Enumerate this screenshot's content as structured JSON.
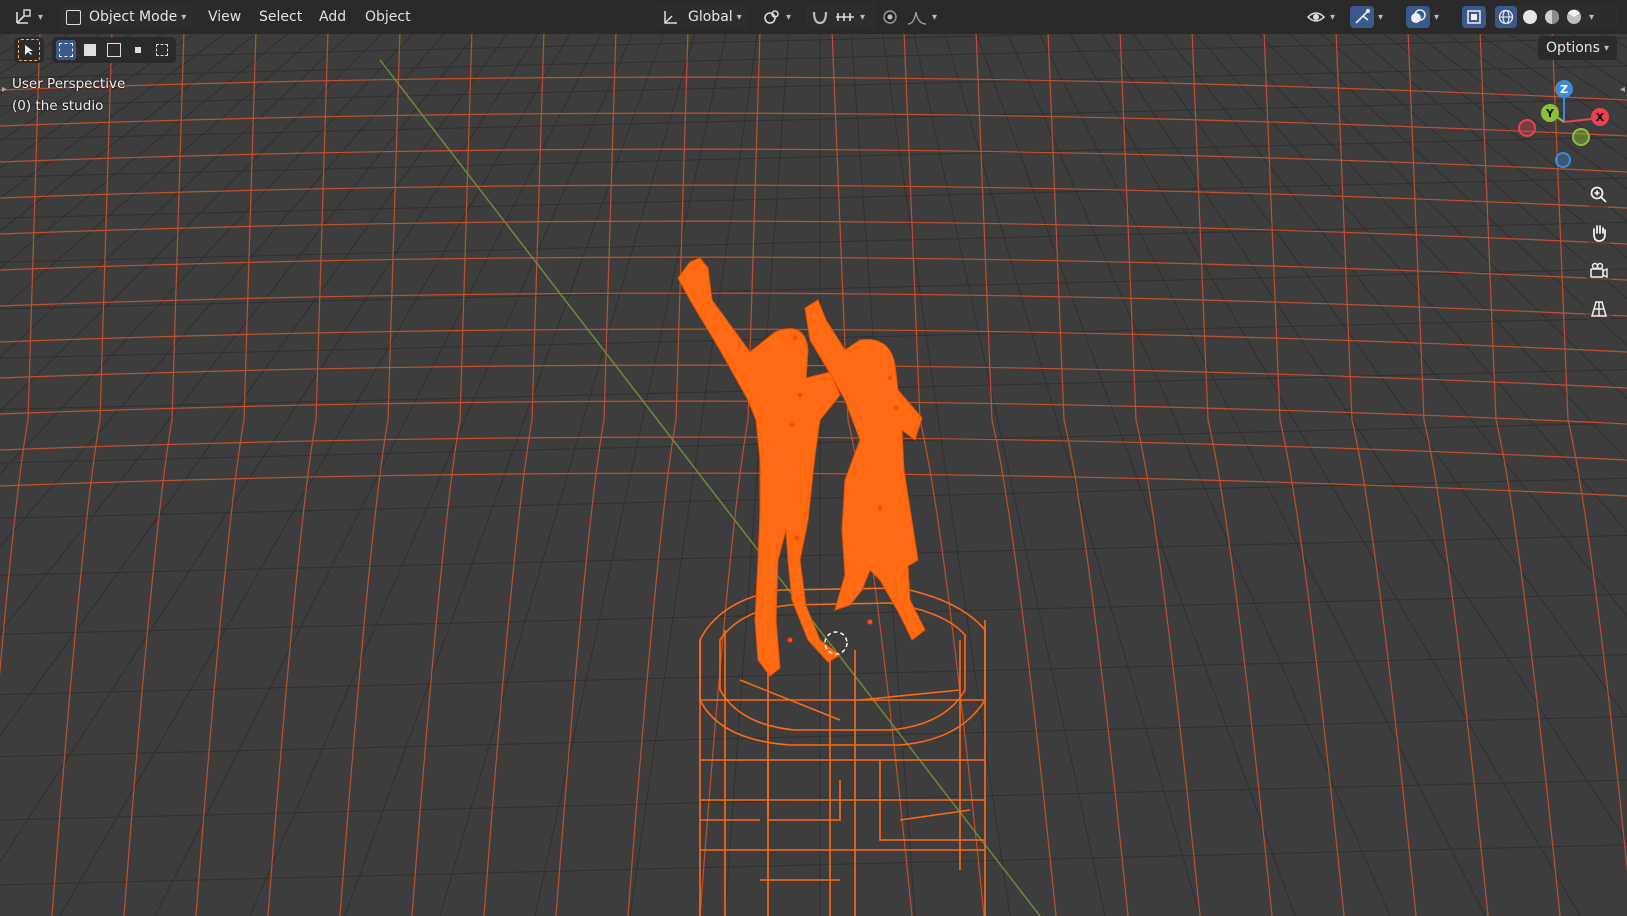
{
  "header": {
    "mode_label": "Object Mode",
    "menus": [
      "View",
      "Select",
      "Add",
      "Object"
    ],
    "transform_orientation": "Global",
    "options_label": "Options"
  },
  "viewport": {
    "view_name": "User Perspective",
    "collection_info": "(0) the studio"
  },
  "gizmo": {
    "axes": [
      "X",
      "Y",
      "Z"
    ],
    "colors": {
      "x": "#e8434f",
      "y": "#8bc03c",
      "z": "#3f8ad6",
      "selection": "#ff6a13"
    }
  },
  "icons": {
    "editor_type": "editor-type-icon",
    "zoom": "zoom-icon",
    "pan": "hand-icon",
    "camera": "camera-icon",
    "grid": "ortho-grid-icon"
  }
}
